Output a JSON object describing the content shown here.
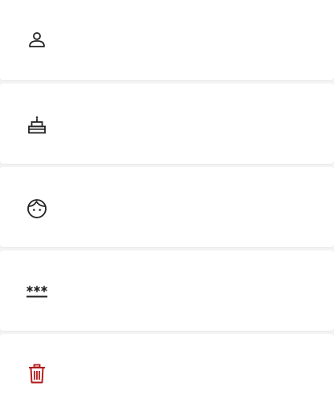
{
  "rows": [
    {
      "icon": "person-icon"
    },
    {
      "icon": "birthday-cake-icon"
    },
    {
      "icon": "face-icon"
    },
    {
      "icon": "password-icon"
    },
    {
      "icon": "trash-icon"
    }
  ],
  "colors": {
    "background": "#f3f3f3",
    "row": "#ffffff",
    "icon": "#222222",
    "delete_icon": "#b01a1a"
  }
}
